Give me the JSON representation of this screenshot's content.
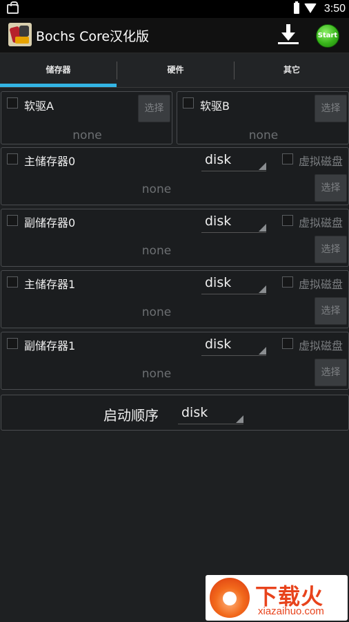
{
  "status_bar": {
    "time": "3:50"
  },
  "action_bar": {
    "title": "Bochs Core汉化版",
    "start_label": "Start"
  },
  "tabs": [
    {
      "label": "储存器"
    },
    {
      "label": "硬件"
    },
    {
      "label": "其它"
    }
  ],
  "floppy": [
    {
      "label": "软驱A",
      "path": "none",
      "select": "选择"
    },
    {
      "label": "软驱B",
      "path": "none",
      "select": "选择"
    }
  ],
  "drives": [
    {
      "label": "主储存器0",
      "type": "disk",
      "virtual": "虚拟磁盘",
      "path": "none",
      "select": "选择"
    },
    {
      "label": "副储存器0",
      "type": "disk",
      "virtual": "虚拟磁盘",
      "path": "none",
      "select": "选择"
    },
    {
      "label": "主储存器1",
      "type": "disk",
      "virtual": "虚拟磁盘",
      "path": "none",
      "select": "选择"
    },
    {
      "label": "副储存器1",
      "type": "disk",
      "virtual": "虚拟磁盘",
      "path": "none",
      "select": "选择"
    }
  ],
  "boot": {
    "label": "启动顺序",
    "value": "disk"
  },
  "watermark": {
    "brand": "下载火",
    "url": "xiazaihuo.com"
  },
  "colors": {
    "accent": "#33b5e5",
    "background": "#1e2022",
    "action_bar": "#111111",
    "watermark": "#e8431c"
  }
}
